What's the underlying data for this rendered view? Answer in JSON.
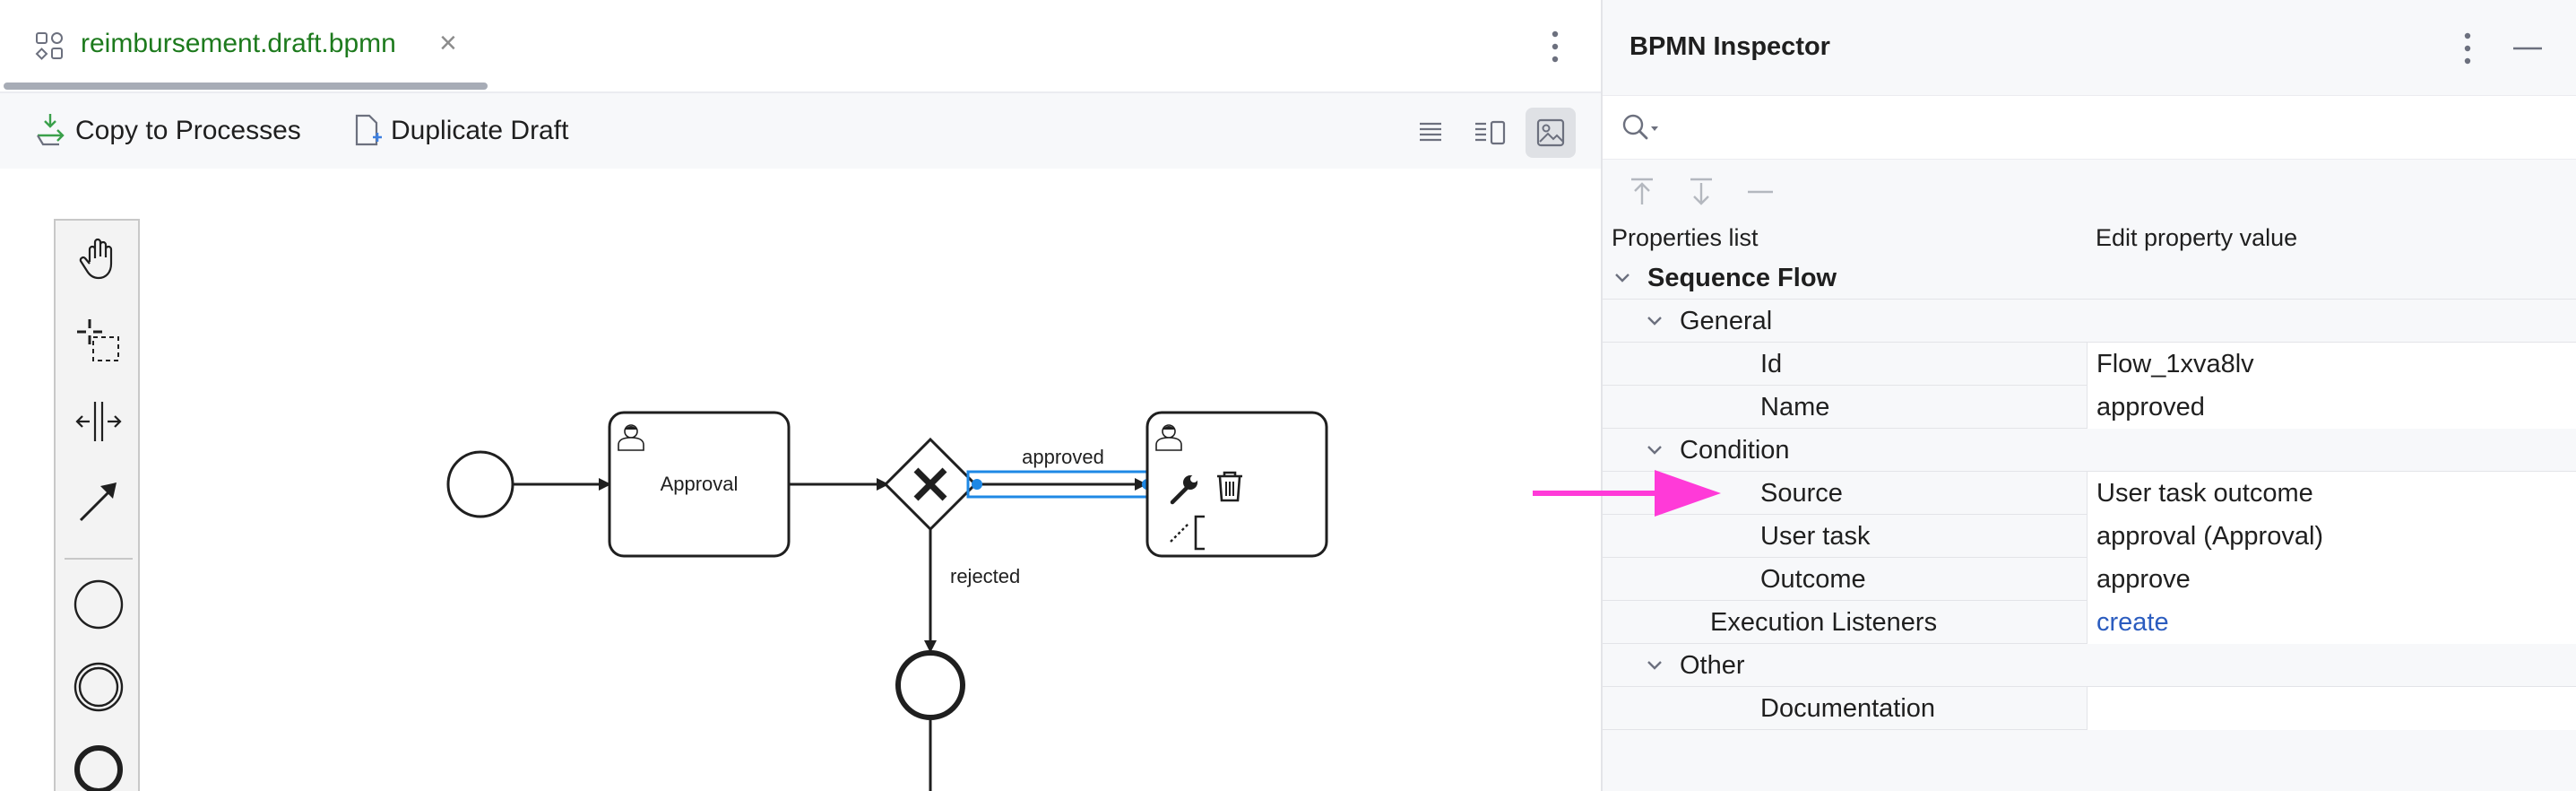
{
  "editor": {
    "tab": {
      "label": "reimbursement.draft.bpmn",
      "close": "×"
    },
    "toolbar": {
      "copy_label": "Copy to Processes",
      "duplicate_label": "Duplicate Draft"
    },
    "diagram": {
      "task_approval_label": "Approval",
      "flow_approved_label": "approved",
      "flow_rejected_label": "rejected"
    }
  },
  "inspector": {
    "title": "BPMN Inspector",
    "search": {
      "value": "",
      "placeholder": ""
    },
    "columns": {
      "name": "Properties list",
      "value": "Edit property value"
    },
    "sections": {
      "root": "Sequence Flow",
      "general": "General",
      "condition": "Condition",
      "other": "Other"
    },
    "properties": {
      "id": {
        "name": "Id",
        "value": "Flow_1xva8lv"
      },
      "name": {
        "name": "Name",
        "value": "approved"
      },
      "source": {
        "name": "Source",
        "value": "User task outcome"
      },
      "user_task": {
        "name": "User task",
        "value": "approval (Approval)"
      },
      "outcome": {
        "name": "Outcome",
        "value": "approve"
      },
      "listeners": {
        "name": "Execution Listeners",
        "value": "create"
      },
      "documentation": {
        "name": "Documentation",
        "value": ""
      }
    }
  },
  "colors": {
    "tab_label": "#1d7a1d",
    "selection": "#1e88e5",
    "annotation_arrow": "#ff3ad8",
    "link": "#2b5cbf"
  }
}
